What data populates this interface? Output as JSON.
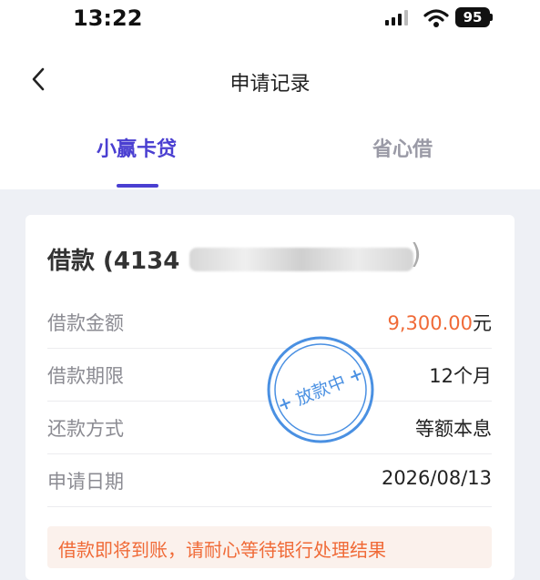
{
  "status_bar": {
    "time": "13:22",
    "battery": "95"
  },
  "nav": {
    "title": "申请记录"
  },
  "tabs": [
    {
      "label": "小赢卡贷",
      "active": true
    },
    {
      "label": "省心借",
      "active": false
    }
  ],
  "card": {
    "title": "借款 (4134",
    "title_end": ")",
    "rows": [
      {
        "label": "借款金额",
        "value": "9,300.00",
        "unit": "元"
      },
      {
        "label": "借款期限",
        "value": "12个月"
      },
      {
        "label": "还款方式",
        "value": "等额本息"
      },
      {
        "label": "申请日期",
        "value": "2026/08/13"
      }
    ],
    "stamp": "放款中",
    "notice": "借款即将到账，请耐心等待银行处理结果"
  },
  "colors": {
    "accent": "#4a3fd1",
    "amount": "#f06a37",
    "stamp": "#4a90e2"
  },
  "icons": {
    "back": "chevron-left-icon",
    "signal": "signal-icon",
    "wifi": "wifi-icon",
    "battery": "battery-icon"
  }
}
